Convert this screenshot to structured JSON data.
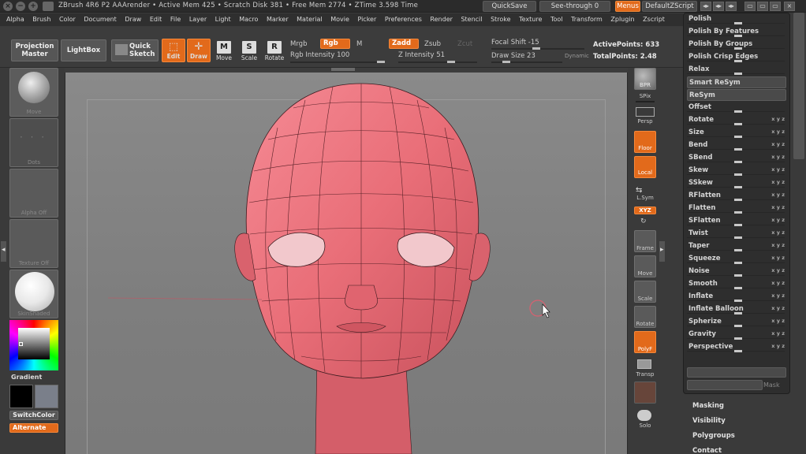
{
  "titlebar": {
    "title": "ZBrush 4R6 P2    AAArender    • Active Mem 425  • Scratch Disk 381  • Free Mem 2774  • ZTime 3.598  Time",
    "quicksave": "QuickSave",
    "seethrough": "See-through  0",
    "menus": "Menus",
    "default_script": "DefaultZScript"
  },
  "menubar": [
    "Alpha",
    "Brush",
    "Color",
    "Document",
    "Draw",
    "Edit",
    "File",
    "Layer",
    "Light",
    "Macro",
    "Marker",
    "Material",
    "Movie",
    "Picker",
    "Preferences",
    "Render",
    "Stencil",
    "Stroke",
    "Texture",
    "Tool",
    "Transform",
    "Zplugin",
    "Zscript"
  ],
  "shelf": {
    "projection_master": "Projection Master",
    "lightbox": "LightBox",
    "quick_sketch": "Quick Sketch",
    "edit": "Edit",
    "draw": "Draw",
    "move": "Move",
    "scale": "Scale",
    "rotate": "Rotate",
    "mrgb": "Mrgb",
    "rgb": "Rgb",
    "m": "M",
    "rgb_intensity": "Rgb Intensity 100",
    "zadd": "Zadd",
    "zsub": "Zsub",
    "zcut": "Zcut",
    "z_intensity": "Z Intensity 51",
    "focal_shift": "Focal Shift -15",
    "draw_size": "Draw Size 23",
    "dynamic": "Dynamic",
    "active_points": "ActivePoints: 633",
    "total_points": "TotalPoints: 2.48"
  },
  "lefttray": {
    "move": "Move",
    "dots": "Dots",
    "alpha": "Alpha Off",
    "texture": "Texture Off",
    "material": "SkinShaded",
    "gradient": "Gradient",
    "switchcolor": "SwitchColor",
    "alternate": "Alternate"
  },
  "rightcol": [
    "BPR",
    "SPix",
    "Persp",
    "Floor",
    "Local",
    "L.Sym",
    "XYZ",
    "Frame",
    "Move",
    "Scale",
    "Rotate",
    "PolyF",
    "Transp",
    "Solo"
  ],
  "panel": {
    "items": [
      {
        "label": "Polish",
        "xyz": ""
      },
      {
        "label": "Polish By Features",
        "xyz": ""
      },
      {
        "label": "Polish By Groups",
        "xyz": ""
      },
      {
        "label": "Polish Crisp Edges",
        "xyz": ""
      },
      {
        "label": "Relax",
        "xyz": ""
      },
      {
        "label": "Smart ReSym",
        "xyz": ""
      },
      {
        "label": "ReSym",
        "xyz": ""
      },
      {
        "label": "Offset",
        "xyz": ""
      },
      {
        "label": "Rotate",
        "xyz": "x y z"
      },
      {
        "label": "Size",
        "xyz": "x y z"
      },
      {
        "label": "Bend",
        "xyz": "x y z"
      },
      {
        "label": "SBend",
        "xyz": "x y z"
      },
      {
        "label": "Skew",
        "xyz": "x y z"
      },
      {
        "label": "SSkew",
        "xyz": "x y z"
      },
      {
        "label": "RFlatten",
        "xyz": "x y z"
      },
      {
        "label": "Flatten",
        "xyz": "x y z"
      },
      {
        "label": "SFlatten",
        "xyz": "x y z"
      },
      {
        "label": "Twist",
        "xyz": "x y z"
      },
      {
        "label": "Taper",
        "xyz": "x y z"
      },
      {
        "label": "Squeeze",
        "xyz": "x y z"
      },
      {
        "label": "Noise",
        "xyz": "x y z"
      },
      {
        "label": "Smooth",
        "xyz": "x y z"
      },
      {
        "label": "Inflate",
        "xyz": "x y z"
      },
      {
        "label": "Inflate Balloon",
        "xyz": "x y z"
      },
      {
        "label": "Spherize",
        "xyz": "x y z"
      },
      {
        "label": "Gravity",
        "xyz": "x y z"
      },
      {
        "label": "Perspective",
        "xyz": "x y z"
      }
    ],
    "mask": "Mask"
  },
  "subpalettes": [
    "Masking",
    "Visibility",
    "Polygroups",
    "Contact"
  ],
  "colors": {
    "accent": "#e26a1b",
    "mesh": "#e96e78"
  }
}
